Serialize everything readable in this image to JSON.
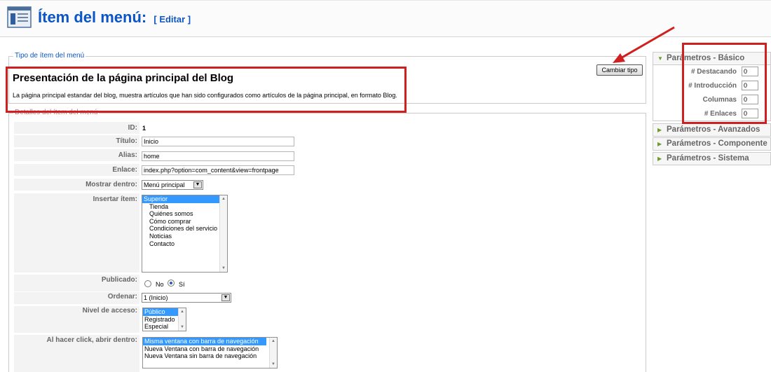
{
  "header": {
    "title": "Ítem del menú:",
    "subtitle": "[ Editar ]"
  },
  "type_section": {
    "legend": "Tipo de ítem del menú",
    "title": "Presentación de la página principal del Blog",
    "description": "La página principal estandar del blog, muestra artículos que han sido configurados como artículos de la página principal, en formato Blog.",
    "change_type_label": "Cambiar tipo"
  },
  "details": {
    "legend": "Detalles del ítem del menú",
    "id_label": "ID:",
    "id_value": "1",
    "title_label": "Título:",
    "title_value": "Inicio",
    "alias_label": "Alias:",
    "alias_value": "home",
    "link_label": "Enlace:",
    "link_value": "index.php?option=com_content&view=frontpage",
    "show_in_label": "Mostrar dentro:",
    "show_in_value": "Menú principal",
    "insert_label": "Insertar ítem:",
    "insert_options": [
      "Superior",
      "Tienda",
      "Quiénes somos",
      "Cómo comprar",
      "Condiciones del servicio",
      "Noticias",
      "Contacto"
    ],
    "insert_selected": "Superior",
    "published_label": "Publicado:",
    "published_no": "No",
    "published_yes": "Sí",
    "published_value": "Sí",
    "order_label": "Ordenar:",
    "order_value": "1 (Inicio)",
    "access_label": "Nivel de acceso:",
    "access_options": [
      "Público",
      "Registrado",
      "Especial"
    ],
    "access_selected": "Público",
    "click_label": "Al hacer click, abrir dentro:",
    "click_options": [
      "Misma ventana con barra de navegación",
      "Nueva Ventana con barra de navegación",
      "Nueva Ventana sin barra de navegación"
    ],
    "click_selected": "Misma ventana con barra de navegación"
  },
  "params": {
    "basic_title": "Parámetros - Básico",
    "fields": [
      {
        "label": "# Destacando",
        "value": "0"
      },
      {
        "label": "# Introducción",
        "value": "0"
      },
      {
        "label": "Columnas",
        "value": "0"
      },
      {
        "label": "# Enlaces",
        "value": "0"
      }
    ],
    "advanced_title": "Parámetros - Avanzados",
    "component_title": "Parámetros - Componente",
    "system_title": "Parámetros - Sistema"
  },
  "colors": {
    "title_blue": "#0b55c4",
    "annotation_red": "#cf1f1f",
    "selection_blue": "#3399ff",
    "accordion_arrow_green": "#6c9a2b"
  }
}
